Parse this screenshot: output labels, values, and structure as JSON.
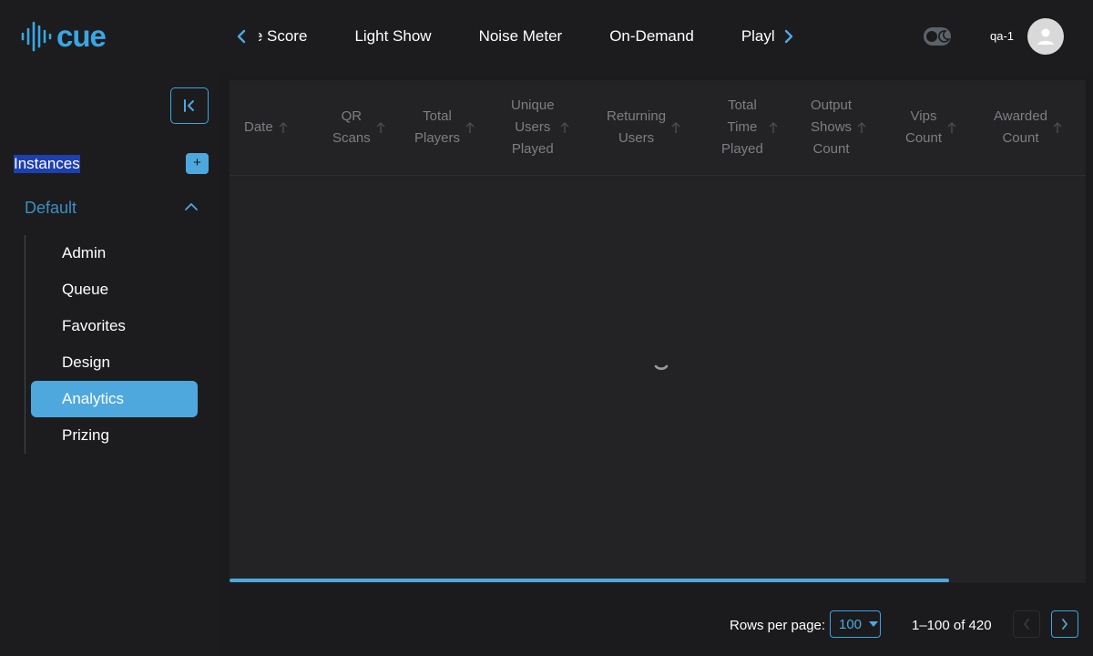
{
  "app": {
    "logo_text": "cue"
  },
  "nav": {
    "tabs": [
      "Game Score",
      "Light Show",
      "Noise Meter",
      "On-Demand",
      "Playlists"
    ],
    "prev_icon": "chevron-left-icon",
    "next_icon": "chevron-right-icon"
  },
  "user": {
    "name": "qa-1",
    "theme_toggle_icon": "moon-icon",
    "avatar_icon": "person-icon"
  },
  "sidebar": {
    "instances_label": "Instances",
    "add_label": "+",
    "group_label": "Default",
    "items": [
      {
        "label": "Admin"
      },
      {
        "label": "Queue"
      },
      {
        "label": "Favorites"
      },
      {
        "label": "Design"
      },
      {
        "label": "Analytics",
        "active": true
      },
      {
        "label": "Prizing"
      }
    ]
  },
  "table": {
    "columns": [
      {
        "line1": "Date"
      },
      {
        "line1": "QR",
        "line2": "Scans"
      },
      {
        "line1": "Total",
        "line2": "Players"
      },
      {
        "line1": "Unique",
        "line2": "Users",
        "line3": "Played"
      },
      {
        "line1": "Returning",
        "line2": "Users"
      },
      {
        "line1": "Total",
        "line2": "Time",
        "line3": "Played"
      },
      {
        "line1": "Output",
        "line2": "Shows",
        "line3": "Count"
      },
      {
        "line1": "Vips",
        "line2": "Count"
      },
      {
        "line1": "Awarded",
        "line2": "Count"
      }
    ],
    "rows": []
  },
  "pagination": {
    "rows_per_page_label": "Rows per page:",
    "rows_per_page_value": "100",
    "range_text": "1–100 of 420"
  },
  "colors": {
    "accent": "#4ea8de",
    "background": "#1b1b1d",
    "surface": "#232325",
    "highlight": "#1e3fae"
  }
}
